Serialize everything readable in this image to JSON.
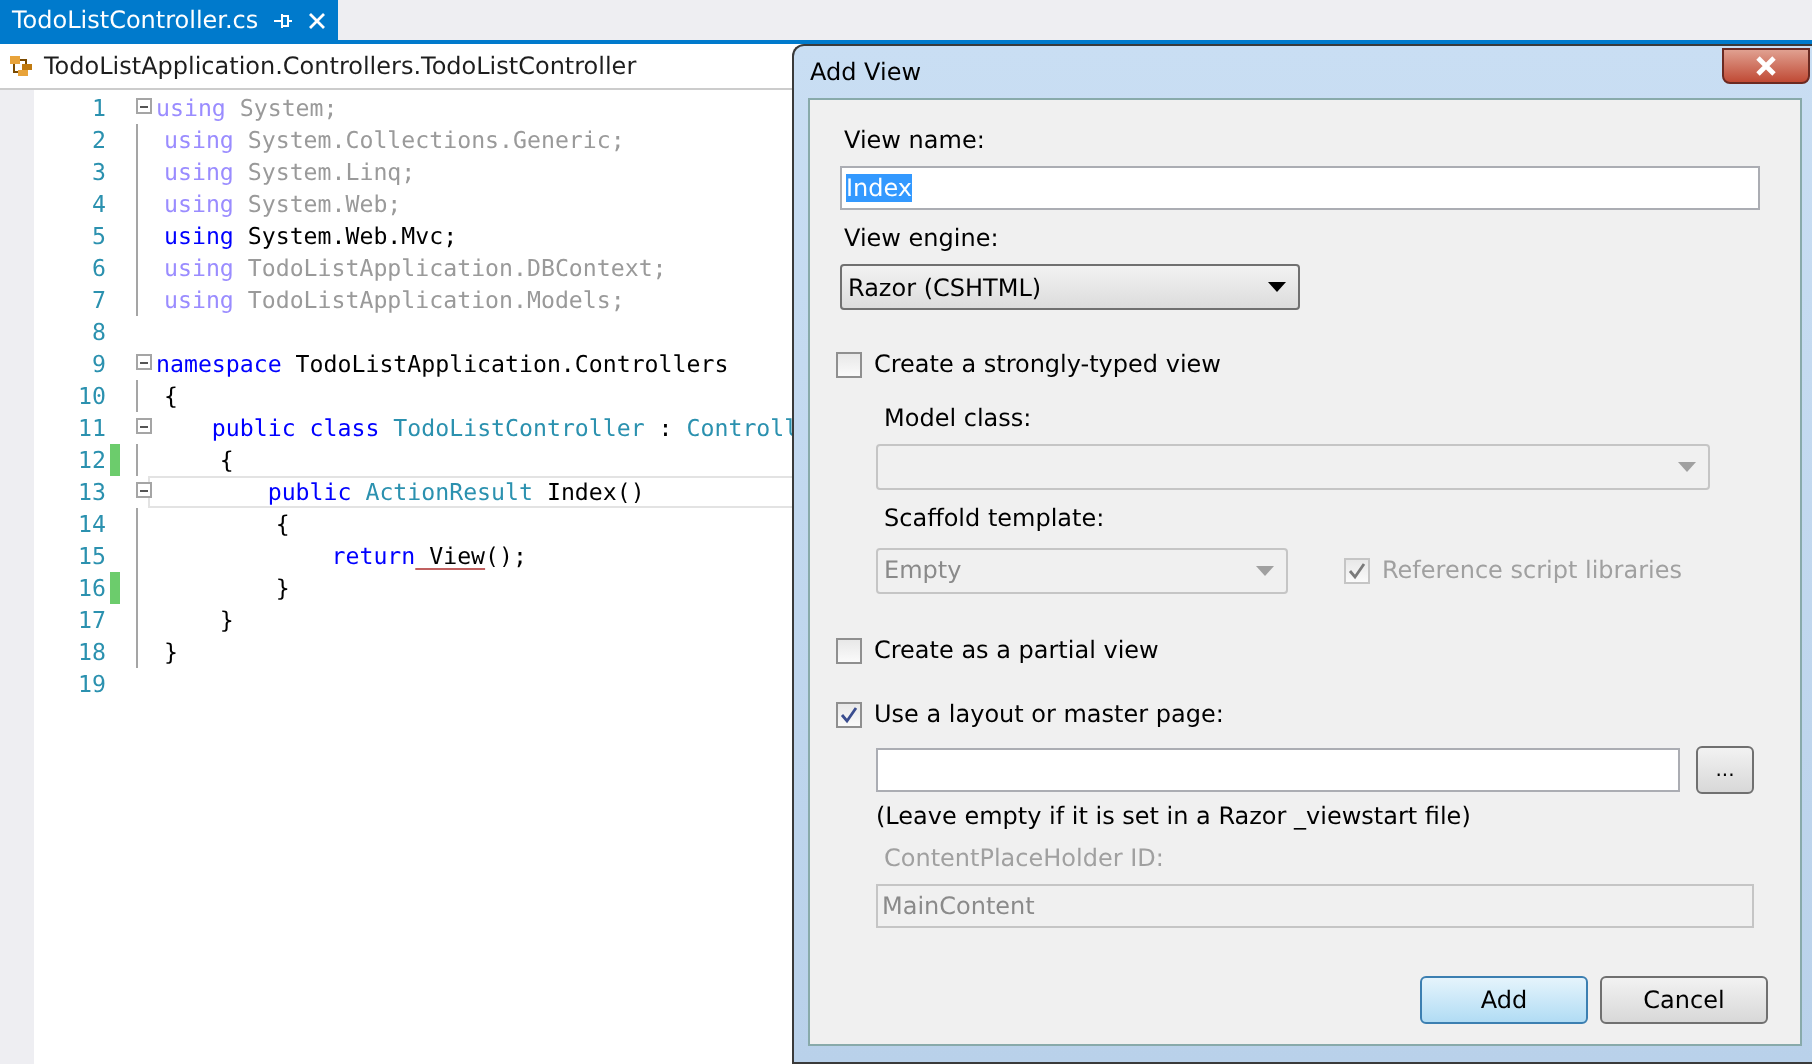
{
  "editor": {
    "tab": {
      "title": "TodoListController.cs",
      "selected": true
    },
    "nav_path": "TodoListApplication.Controllers.TodoListController",
    "lines": [
      {
        "number": "1",
        "collapsible": true,
        "tokens": [
          {
            "text": "using",
            "kind": "dimkw"
          },
          {
            "text": " System;",
            "kind": "dim"
          }
        ]
      },
      {
        "number": "2",
        "tokens": [
          {
            "text": "using",
            "kind": "dimkw"
          },
          {
            "text": " System.Collections.Generic;",
            "kind": "dim"
          }
        ]
      },
      {
        "number": "3",
        "tokens": [
          {
            "text": "using",
            "kind": "dimkw"
          },
          {
            "text": " System.Linq;",
            "kind": "dim"
          }
        ]
      },
      {
        "number": "4",
        "tokens": [
          {
            "text": "using",
            "kind": "dimkw"
          },
          {
            "text": " System.Web;",
            "kind": "dim"
          }
        ]
      },
      {
        "number": "5",
        "tokens": [
          {
            "text": "using",
            "kind": "kw"
          },
          {
            "text": " System.Web.Mvc;",
            "kind": "plain"
          }
        ]
      },
      {
        "number": "6",
        "tokens": [
          {
            "text": "using",
            "kind": "dimkw"
          },
          {
            "text": " TodoListApplication.DBContext;",
            "kind": "dim"
          }
        ]
      },
      {
        "number": "7",
        "tokens": [
          {
            "text": "using",
            "kind": "dimkw"
          },
          {
            "text": " TodoListApplication.Models;",
            "kind": "dim"
          }
        ]
      },
      {
        "number": "8"
      },
      {
        "number": "9",
        "collapsible": true,
        "tokens": [
          {
            "text": "namespace",
            "kind": "kw"
          },
          {
            "text": " TodoListApplication.Controllers",
            "kind": "plain"
          }
        ]
      },
      {
        "number": "10",
        "tokens": [
          {
            "text": "{",
            "kind": "plain"
          }
        ]
      },
      {
        "number": "11",
        "collapsible": true,
        "tokens": [
          {
            "text": "    public",
            "kind": "kw"
          },
          {
            "text": " class",
            "kind": "kw"
          },
          {
            "text": " TodoListController",
            "kind": "type"
          },
          {
            "text": " : ",
            "kind": "plain"
          },
          {
            "text": "Controll",
            "kind": "type"
          }
        ]
      },
      {
        "number": "12",
        "changed": true,
        "tokens": [
          {
            "text": "    {",
            "kind": "plain"
          }
        ]
      },
      {
        "number": "13",
        "collapsible": true,
        "current": true,
        "tokens": [
          {
            "text": "        public",
            "kind": "kw"
          },
          {
            "text": " ActionResult",
            "kind": "type"
          },
          {
            "text": " Index()",
            "kind": "plain"
          }
        ]
      },
      {
        "number": "14",
        "tokens": [
          {
            "text": "        {",
            "kind": "plain"
          }
        ]
      },
      {
        "number": "15",
        "tokens": [
          {
            "text": "            return",
            "kind": "kw"
          },
          {
            "text": " View",
            "kind": "error"
          },
          {
            "text": "();",
            "kind": "plain"
          }
        ]
      },
      {
        "number": "16",
        "changed": true,
        "tokens": [
          {
            "text": "        }",
            "kind": "plain"
          }
        ]
      },
      {
        "number": "17",
        "tokens": [
          {
            "text": "    }",
            "kind": "plain"
          }
        ]
      },
      {
        "number": "18",
        "tokens": [
          {
            "text": "}",
            "kind": "plain"
          }
        ]
      },
      {
        "number": "19"
      }
    ]
  },
  "dialog": {
    "title": "Add View",
    "view_name": {
      "label": "View name:",
      "value": "Index"
    },
    "view_engine": {
      "label": "View engine:",
      "value": "Razor (CSHTML)"
    },
    "strongly_typed": {
      "label": "Create a strongly-typed view",
      "checked": false
    },
    "model_class": {
      "label": "Model class:",
      "disabled": true
    },
    "scaffold_template": {
      "label": "Scaffold template:",
      "value": "Empty",
      "disabled": true
    },
    "reference_scripts": {
      "label": "Reference script libraries",
      "checked": true,
      "disabled": true
    },
    "partial_view": {
      "label": "Create as a partial view",
      "checked": false
    },
    "use_layout": {
      "label": "Use a layout or master page:",
      "checked": true
    },
    "browse_button": "...",
    "layout_hint": "(Leave empty if it is set in a Razor _viewstart file)",
    "placeholder_id": {
      "label": "ContentPlaceHolder ID:",
      "value": "MainContent",
      "disabled": true
    },
    "buttons": [
      {
        "label": "Add",
        "default": true
      },
      {
        "label": "Cancel",
        "default": false
      }
    ]
  }
}
